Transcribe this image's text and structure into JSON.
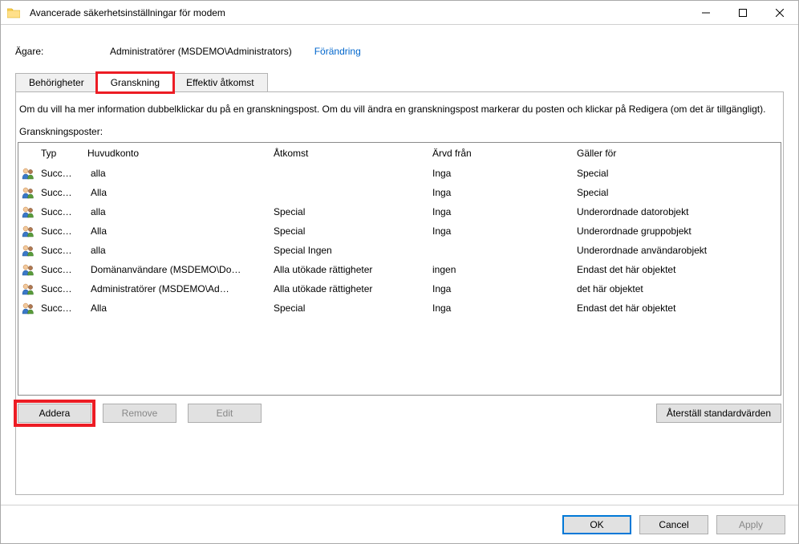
{
  "window": {
    "title": "Avancerade säkerhetsinställningar för modem"
  },
  "owner": {
    "label": "Ägare:",
    "value": "Administratörer (MSDEMO\\Administrators)",
    "change_link": "Förändring"
  },
  "tabs": {
    "permissions": "Behörigheter",
    "auditing": "Granskning",
    "effective": "Effektiv åtkomst"
  },
  "instruction": "Om du vill ha mer information dubbelklickar du på en granskningspost. Om du vill ändra en granskningspost markerar du posten och klickar på Redigera (om det är tillgängligt).",
  "list_label": "Granskningsposter:",
  "columns": {
    "type": "Typ",
    "principal": "Huvudkonto",
    "access": "Åtkomst",
    "inherited": "Ärvd från",
    "applies": "Gäller för"
  },
  "rows": [
    {
      "type": "Succ…",
      "principal": "alla",
      "access": "",
      "inherited": "Inga",
      "applies": "Special"
    },
    {
      "type": "Succ…",
      "principal": "Alla",
      "access": "",
      "inherited": "Inga",
      "applies": "Special"
    },
    {
      "type": "Succ…",
      "principal": "alla",
      "access": "Special",
      "inherited": "Inga",
      "applies": "Underordnade datorobjekt"
    },
    {
      "type": "Succ…",
      "principal": "Alla",
      "access": "Special",
      "inherited": "Inga",
      "applies": "Underordnade gruppobjekt"
    },
    {
      "type": "Succ…",
      "principal": "alla",
      "access": "Special          Ingen",
      "inherited": "",
      "applies": "Underordnade användarobjekt"
    },
    {
      "type": "Succ…",
      "principal": "Domänanvändare (MSDEMO\\Do…",
      "access": "Alla utökade rättigheter",
      "inherited": "ingen",
      "applies": "Endast det här objektet"
    },
    {
      "type": "Succ…",
      "principal": "Administratörer (MSDEMO\\Ad…",
      "access": "Alla utökade rättigheter",
      "inherited": "Inga",
      "applies": " det här objektet"
    },
    {
      "type": "Succ…",
      "principal": "Alla",
      "access": "Special",
      "inherited": "Inga",
      "applies": "Endast det här objektet"
    }
  ],
  "buttons": {
    "add": "Addera",
    "remove": "Remove",
    "edit": "Edit",
    "restore": "Återställ standardvärden",
    "ok": "OK",
    "cancel": "Cancel",
    "apply": "Apply"
  }
}
